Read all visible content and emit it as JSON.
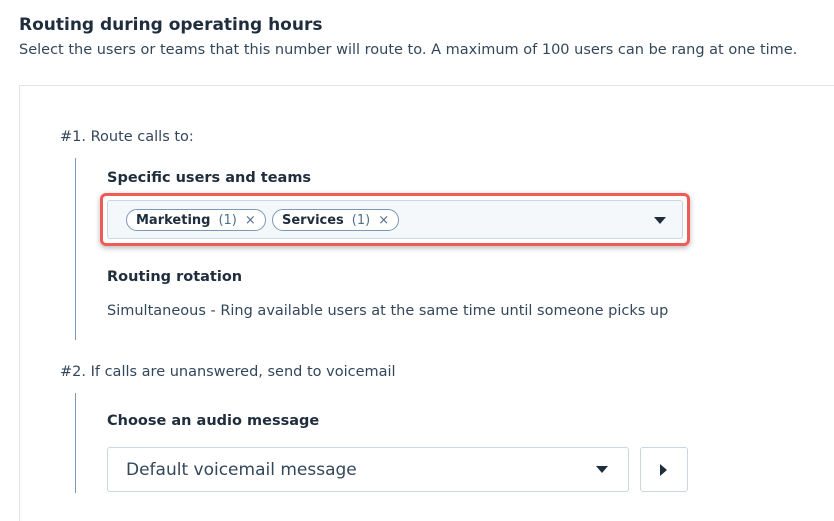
{
  "section": {
    "title": "Routing during operating hours",
    "description": "Select the users or teams that this number will route to. A maximum of 100 users can be rang at one time."
  },
  "step1": {
    "label": "#1. Route calls to:",
    "specific_label": "Specific users and teams",
    "tags": [
      {
        "name": "Marketing",
        "count": "(1)",
        "remove": "×"
      },
      {
        "name": "Services",
        "count": "(1)",
        "remove": "×"
      }
    ],
    "dropdown_icon": "caret-down-icon",
    "rotation_label": "Routing rotation",
    "rotation_value": "Simultaneous - Ring available users at the same time until someone picks up"
  },
  "step2": {
    "label": "#2. If calls are unanswered, send to voicemail",
    "audio_label": "Choose an audio message",
    "audio_value": "Default voicemail message",
    "dropdown_icon": "caret-down-icon",
    "play_icon": "play-icon"
  },
  "colors": {
    "highlight": "#ef5b56",
    "text_dark": "#1f2d3d",
    "text": "#33475b",
    "border": "#cbd6e2"
  }
}
